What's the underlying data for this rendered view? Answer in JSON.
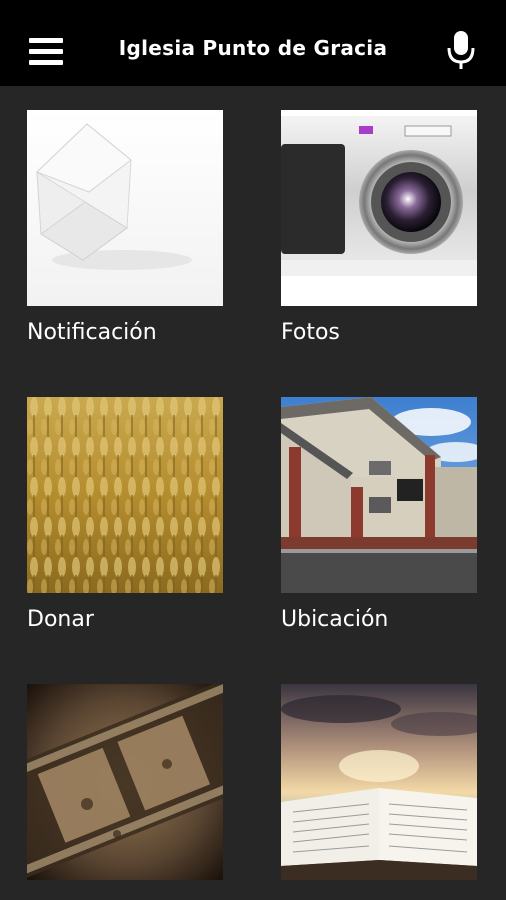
{
  "appbar": {
    "title": "Iglesia Punto de Gracia",
    "menu_icon": "hamburger-menu-icon",
    "mic_icon": "microphone-icon"
  },
  "tiles": [
    {
      "label": "Notificación",
      "image": "envelope-image"
    },
    {
      "label": "Fotos",
      "image": "camera-image"
    },
    {
      "label": "Donar",
      "image": "wheat-field-image"
    },
    {
      "label": "Ubicación",
      "image": "church-building-image"
    },
    {
      "label": "",
      "image": "film-strip-image"
    },
    {
      "label": "",
      "image": "open-bible-image"
    }
  ],
  "colors": {
    "appbar_bg": "#000000",
    "page_bg": "#262626",
    "text": "#ffffff"
  }
}
